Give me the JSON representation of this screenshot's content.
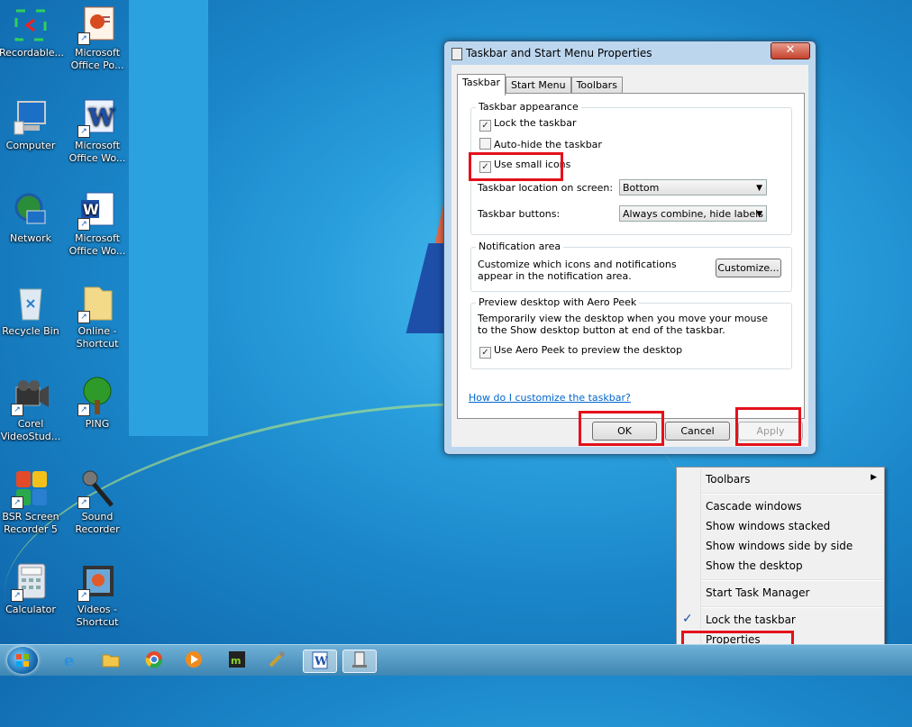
{
  "desktop": {
    "icons": [
      {
        "label": "Recordable..."
      },
      {
        "label": "Microsoft Office Po..."
      },
      {
        "label": "Computer"
      },
      {
        "label": "Microsoft Office Wo..."
      },
      {
        "label": "Network"
      },
      {
        "label": "Microsoft Office Wo..."
      },
      {
        "label": "Recycle Bin"
      },
      {
        "label": "Online - Shortcut"
      },
      {
        "label": "Corel VideoStud..."
      },
      {
        "label": "PING"
      },
      {
        "label": "BSR Screen Recorder 5"
      },
      {
        "label": "Sound Recorder"
      },
      {
        "label": "Calculator"
      },
      {
        "label": "Videos - Shortcut"
      }
    ]
  },
  "dialog": {
    "title": "Taskbar and Start Menu Properties",
    "close": "✕",
    "tabs": [
      "Taskbar",
      "Start Menu",
      "Toolbars"
    ],
    "appearance": {
      "legend": "Taskbar appearance",
      "lock": "Lock the taskbar",
      "lock_checked": true,
      "autohide": "Auto-hide the taskbar",
      "autohide_checked": false,
      "small_icons": "Use small icons",
      "small_icons_checked": true,
      "location_label": "Taskbar location on screen:",
      "location_value": "Bottom",
      "buttons_label": "Taskbar buttons:",
      "buttons_value": "Always combine, hide labels"
    },
    "notification": {
      "legend": "Notification area",
      "text": "Customize which icons and notifications appear in the notification area.",
      "customize": "Customize..."
    },
    "peek": {
      "legend": "Preview desktop with Aero Peek",
      "text": "Temporarily view the desktop when you move your mouse to the Show desktop button at end of the taskbar.",
      "checkbox": "Use Aero Peek to preview the desktop",
      "checked": true
    },
    "help_link": "How do I customize the taskbar?",
    "ok": "OK",
    "cancel": "Cancel",
    "apply": "Apply"
  },
  "context_menu": {
    "toolbars": "Toolbars",
    "cascade": "Cascade windows",
    "stacked": "Show windows stacked",
    "side_by_side": "Show windows side by side",
    "show_desktop": "Show the desktop",
    "task_manager": "Start Task Manager",
    "lock": "Lock the taskbar",
    "lock_check": "✓",
    "properties": "Properties"
  },
  "colors": {
    "highlight": "#e4111b",
    "link": "#0066cc"
  }
}
